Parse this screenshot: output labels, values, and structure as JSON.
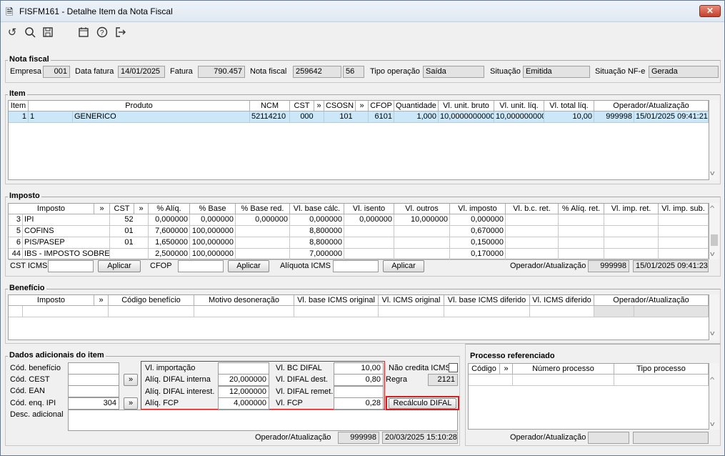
{
  "window": {
    "title": "FISFM161 - Detalhe Item da Nota Fiscal",
    "close": "✕"
  },
  "toolbar": {
    "icons": [
      "undo-icon",
      "search-icon",
      "save-icon",
      "calendar-icon",
      "help-icon",
      "exit-icon"
    ]
  },
  "nota": {
    "title": "Nota fiscal",
    "empresa_label": "Empresa",
    "empresa": "001",
    "data_fatura_label": "Data fatura",
    "data_fatura": "14/01/2025",
    "fatura_label": "Fatura",
    "fatura": "790.457",
    "nota_fiscal_label": "Nota fiscal",
    "nota_fiscal": "259642",
    "serie": "56",
    "tipo_operacao_label": "Tipo operação",
    "tipo_operacao": "Saída",
    "situacao_label": "Situação",
    "situacao": "Emitida",
    "situacao_nfe_label": "Situação NF-e",
    "situacao_nfe": "Gerada"
  },
  "item": {
    "title": "Item",
    "headers": [
      "Item",
      "Produto",
      "NCM",
      "CST",
      "»",
      "CSOSN",
      "»",
      "CFOP",
      "Quantidade",
      "Vl. unit. bruto",
      "Vl. unit. líq.",
      "Vl. total líq.",
      "Operador/Atualização"
    ],
    "row": [
      "1",
      "1",
      "GENERICO",
      "52114210",
      "000",
      "101",
      "6101",
      "1,000",
      "10,0000000000",
      "10,000000000",
      "10,00",
      "999998",
      "15/01/2025 09:41:21"
    ]
  },
  "imposto": {
    "title": "Imposto",
    "headers": [
      "Imposto",
      "»",
      "CST",
      "»",
      "% Alíq.",
      "% Base",
      "% Base red.",
      "Vl. base cálc.",
      "Vl. isento",
      "Vl. outros",
      "Vl. imposto",
      "Vl. b.c. ret.",
      "% Alíq. ret.",
      "Vl. imp. ret.",
      "Vl. imp. sub."
    ],
    "rows": [
      [
        "3",
        "IPI",
        "52",
        "0,000000",
        "0,000000",
        "0,000000",
        "0,000000",
        "0,000000",
        "10,000000",
        "0,000000"
      ],
      [
        "5",
        "COFINS",
        "01",
        "7,600000",
        "100,000000",
        "",
        "8,800000",
        "",
        "",
        "0,670000"
      ],
      [
        "6",
        "PIS/PASEP",
        "01",
        "1,650000",
        "100,000000",
        "",
        "8,800000",
        "",
        "",
        "0,150000"
      ],
      [
        "44",
        "IBS - IMPOSTO SOBRE B",
        "",
        "2,500000",
        "100,000000",
        "",
        "7,000000",
        "",
        "",
        "0,170000"
      ]
    ],
    "cst_icms_label": "CST ICMS",
    "cfop_label": "CFOP",
    "aliquota_label": "Alíquota ICMS",
    "aplicar": "Aplicar",
    "operador_label": "Operador/Atualização",
    "operador": "999998",
    "atualizacao": "15/01/2025 09:41:23"
  },
  "beneficio": {
    "title": "Benefício",
    "headers": [
      "Imposto",
      "»",
      "Código benefício",
      "Motivo desoneração",
      "Vl. base ICMS original",
      "Vl. ICMS original",
      "Vl. base ICMS diferido",
      "Vl. ICMS diferido",
      "Operador/Atualização"
    ]
  },
  "dados": {
    "title": "Dados adicionais do item",
    "cod_beneficio_label": "Cód. benefício",
    "cod_cest_label": "Cód. CEST",
    "cod_ean_label": "Cód. EAN",
    "cod_enq_ipi_label": "Cód. enq. IPI",
    "cod_enq_ipi": "304",
    "desc_adicional_label": "Desc. adicional",
    "arrow": "»",
    "vl_importacao_label": "Vl. importação",
    "aliq_difal_interna_label": "Alíq. DIFAL interna",
    "aliq_difal_interna": "20,000000",
    "aliq_difal_interest_label": "Alíq. DIFAL interest.",
    "aliq_difal_interest": "12,000000",
    "aliq_fcp_label": "Alíq. FCP",
    "aliq_fcp": "4,000000",
    "vl_bc_difal_label": "Vl. BC DIFAL",
    "vl_bc_difal": "10,00",
    "vl_difal_dest_label": "Vl. DIFAL dest.",
    "vl_difal_dest": "0,80",
    "vl_difal_remet_label": "Vl. DIFAL remet.",
    "vl_fcp_label": "Vl. FCP",
    "vl_fcp": "0,28",
    "nao_credita_label": "Não credita ICMS",
    "regra_label": "Regra",
    "regra": "2121",
    "recalculo": "Recálculo DIFAL",
    "operador_label": "Operador/Atualização",
    "operador": "999998",
    "atualizacao": "20/03/2025 15:10:28"
  },
  "processo": {
    "title": "Processo referenciado",
    "headers": [
      "Código",
      "»",
      "Número processo",
      "Tipo processo"
    ],
    "operador_label": "Operador/Atualização"
  }
}
